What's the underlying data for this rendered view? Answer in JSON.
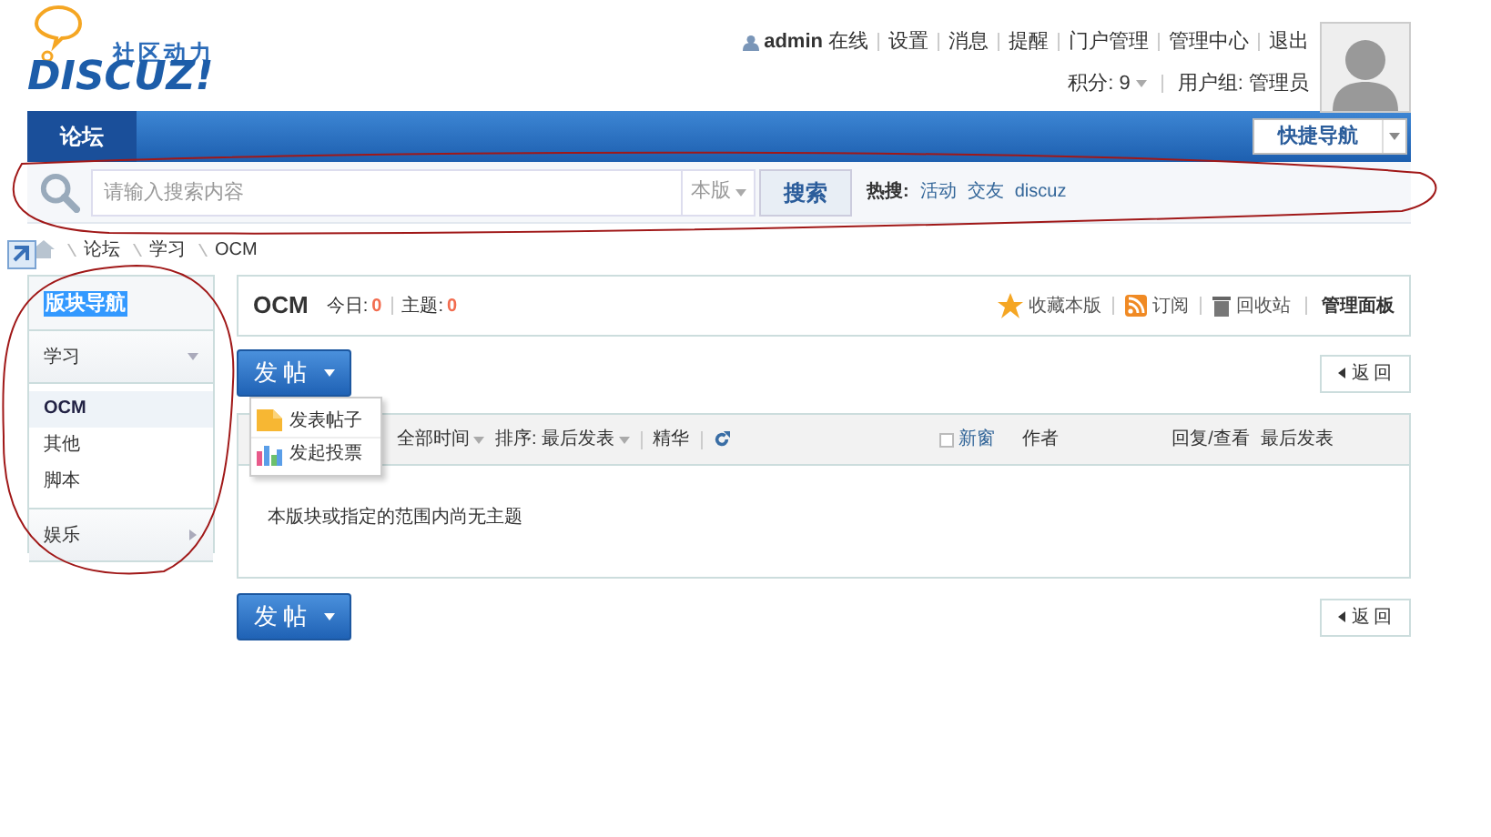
{
  "logo": {
    "tagline": "社区动力",
    "wordmark": "DISCUZ!"
  },
  "user_bar": {
    "username": "admin",
    "status": "在线",
    "links": [
      "设置",
      "消息",
      "提醒",
      "门户管理",
      "管理中心",
      "退出"
    ],
    "points_label": "积分: 9",
    "group": "用户组: 管理员"
  },
  "nav": {
    "tabs": [
      {
        "label": "论坛",
        "selected": true
      }
    ],
    "quick_nav": "快捷导航"
  },
  "search": {
    "placeholder": "请输入搜索内容",
    "scope": "本版",
    "button": "搜索",
    "hot_label": "热搜:",
    "hot_terms": [
      "活动",
      "交友",
      "discuz"
    ]
  },
  "breadcrumb": [
    "论坛",
    "学习",
    "OCM"
  ],
  "sidebar": {
    "title": "版块导航",
    "groups": [
      {
        "label": "学习",
        "expanded": true,
        "children": [
          {
            "label": "OCM",
            "selected": true
          },
          {
            "label": "其他",
            "selected": false
          },
          {
            "label": "脚本",
            "selected": false
          }
        ]
      },
      {
        "label": "娱乐",
        "expanded": false
      }
    ]
  },
  "forum": {
    "name": "OCM",
    "today_label": "今日:",
    "today": "0",
    "threads_label": "主题:",
    "threads": "0",
    "actions": [
      "收藏本版",
      "订阅",
      "回收站"
    ],
    "admin_panel": "管理面板"
  },
  "post_buttons": [
    "发帖",
    "发帖"
  ],
  "back_buttons": [
    "返回",
    "返回"
  ],
  "post_menu": [
    {
      "label": "发表帖子",
      "kind": "thread"
    },
    {
      "label": "发起投票",
      "kind": "poll"
    }
  ],
  "filters": {
    "time": "全部时间",
    "sort": "排序: 最后发表",
    "digest": "精华"
  },
  "columns": {
    "new_window": {
      "label": "新窗",
      "checked": false
    },
    "author": "作者",
    "replies": "回复/查看",
    "last_post": "最后发表"
  },
  "empty_message": "本版块或指定的范围内尚无主题"
}
